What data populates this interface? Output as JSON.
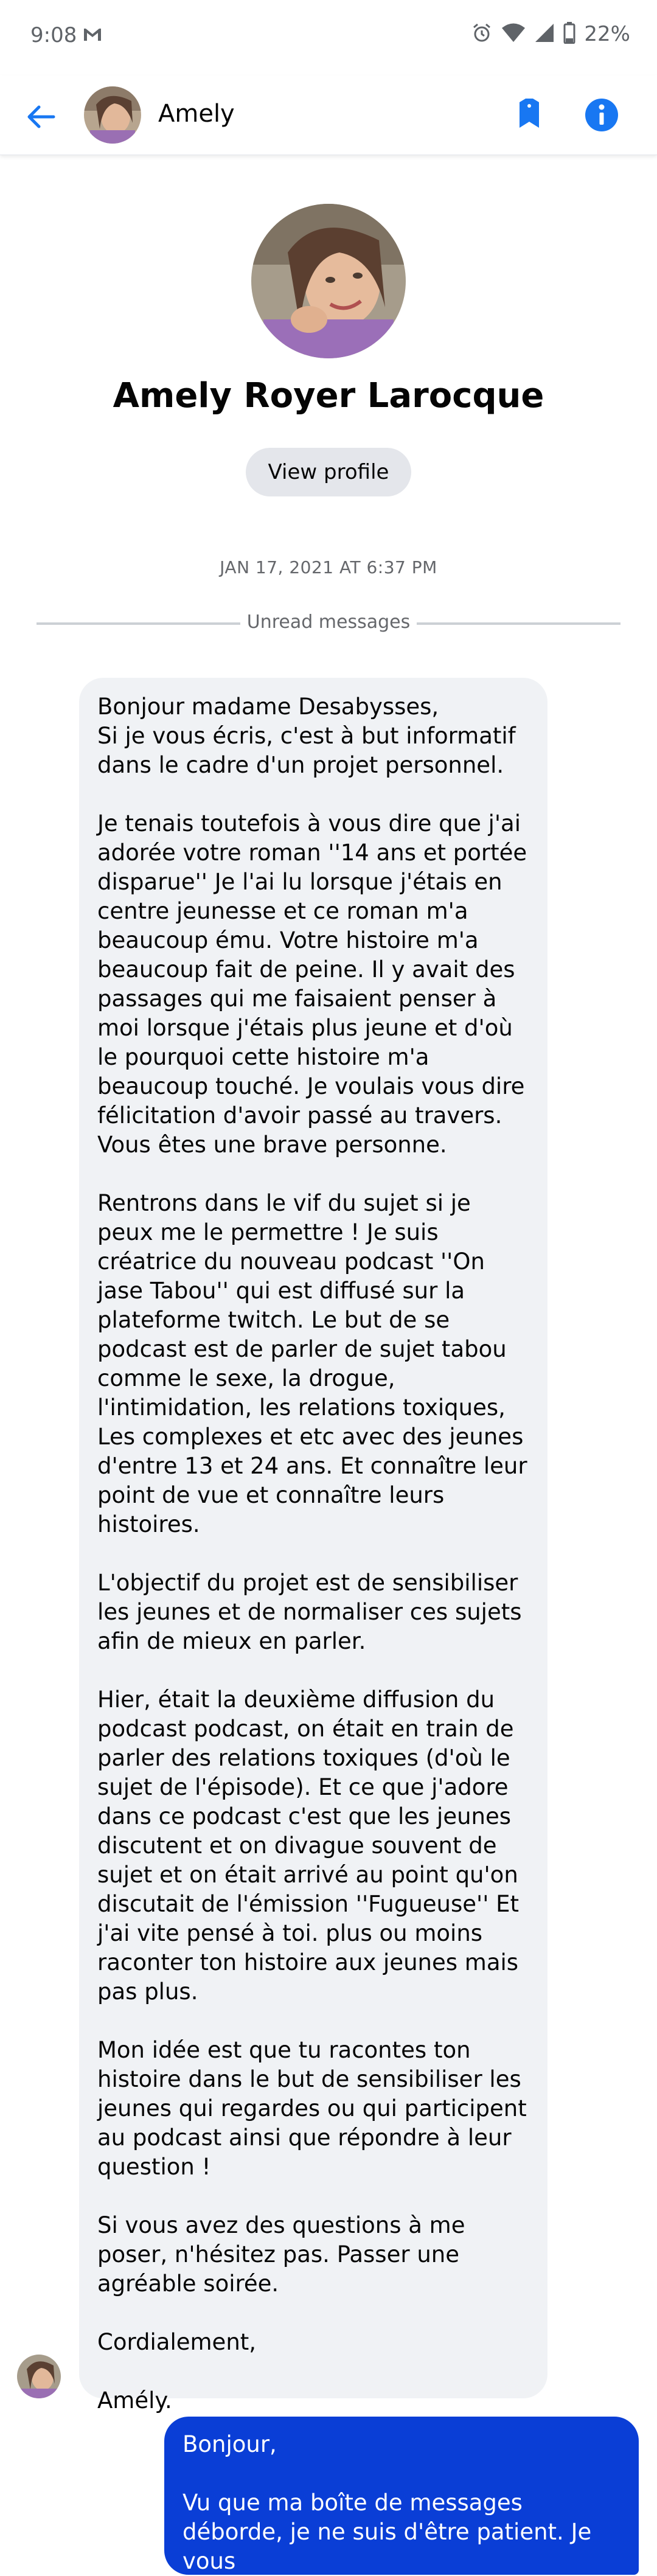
{
  "status_bar": {
    "time": "9:08",
    "battery": "22%",
    "icons": [
      "gmail-icon",
      "alarm-icon",
      "wifi-icon",
      "cell-signal-icon",
      "battery-icon"
    ]
  },
  "header": {
    "contact_name": "Amely",
    "icons": [
      "back-arrow-icon",
      "tag-icon",
      "info-icon"
    ],
    "accent_color": "#1877f2"
  },
  "profile": {
    "full_name": "Amely Royer Larocque",
    "view_profile_label": "View profile"
  },
  "conversation": {
    "timestamp": "JAN 17, 2021 AT 6:37 PM",
    "unread_label": "Unread messages",
    "incoming_message": {
      "paragraphs": [
        "Bonjour madame Desabysses,\nSi je vous écris, c'est à but informatif dans le cadre d'un projet personnel.",
        "Je tenais toutefois à vous dire que j'ai adorée votre roman ''14 ans et portée disparue'' Je l'ai lu lorsque j'étais en centre jeunesse et ce roman m'a beaucoup ému. Votre histoire m'a beaucoup fait de peine. Il y avait des passages qui me faisaient penser à moi lorsque j'étais plus jeune et d'où le pourquoi cette histoire m'a beaucoup touché. Je voulais vous dire félicitation d'avoir passé au travers. Vous êtes une brave personne.",
        "Rentrons dans le vif du sujet si je peux me le permettre ! Je suis créatrice du nouveau podcast ''On jase Tabou'' qui est diffusé sur la plateforme twitch. Le but de se podcast est de parler de sujet tabou comme le sexe, la drogue, l'intimidation, les relations toxiques, Les complexes et etc avec des jeunes d'entre 13 et 24 ans. Et connaître leur point de vue et connaître leurs histoires.",
        "L'objectif du projet est de sensibiliser les jeunes et de normaliser ces sujets afin de mieux en parler.",
        "Hier, était la deuxième diffusion du podcast podcast, on était en train de parler des relations toxiques (d'où le sujet de l'épisode). Et ce que j'adore dans ce podcast c'est que les jeunes discutent et on divague souvent de sujet et on était arrivé au point qu'on discutait de l'émission ''Fugueuse'' Et j'ai vite pensé à toi. plus ou moins raconter ton histoire aux jeunes mais pas plus.",
        "Mon idée est que tu racontes ton histoire dans le but de sensibiliser les jeunes qui regardes ou qui participent au podcast ainsi que répondre à leur question !",
        "Si vous avez des questions à me poser, n'hésitez pas. Passer une agréable soirée.",
        "Cordialement,",
        "Amély."
      ]
    },
    "outgoing_message": {
      "paragraphs": [
        "Bonjour,",
        "Vu que ma boîte de messages déborde, je ne suis d'être patient. Je vous"
      ],
      "bubble_color": "#0a3ed6"
    }
  }
}
